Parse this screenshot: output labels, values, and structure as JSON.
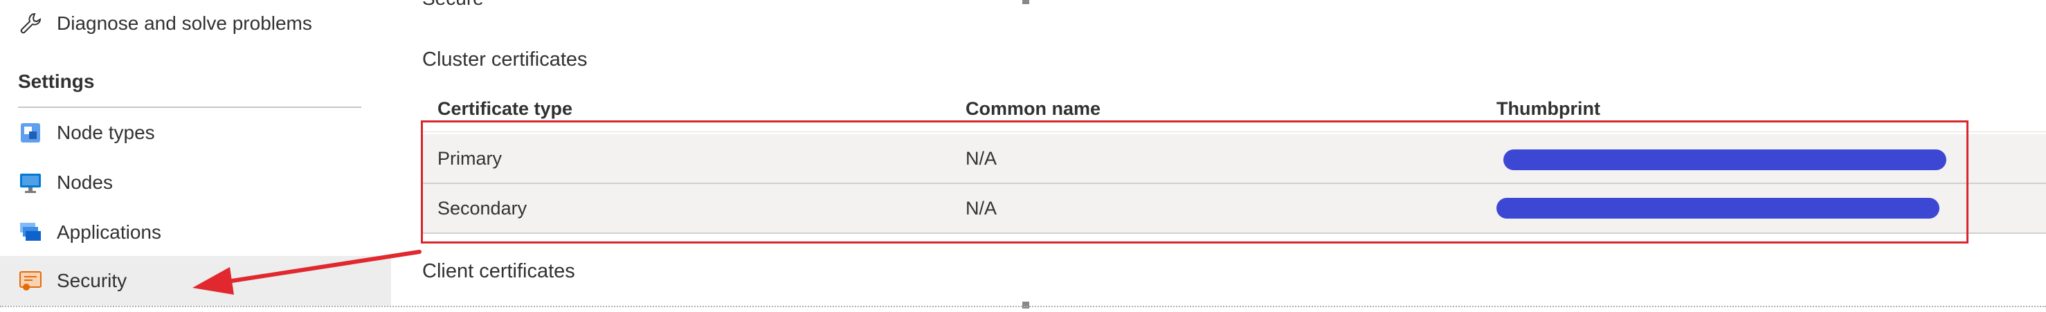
{
  "sidebar": {
    "diagnose_label": "Diagnose and solve problems",
    "settings_heading": "Settings",
    "items": [
      {
        "label": "Node types",
        "icon": "node-types-icon"
      },
      {
        "label": "Nodes",
        "icon": "nodes-icon"
      },
      {
        "label": "Applications",
        "icon": "applications-icon"
      },
      {
        "label": "Security",
        "icon": "security-icon",
        "selected": true
      }
    ]
  },
  "main": {
    "secure_label": "Secure",
    "cluster_certificates_heading": "Cluster certificates",
    "client_certificates_heading": "Client certificates",
    "table": {
      "columns": [
        "Certificate type",
        "Common name",
        "Thumbprint"
      ],
      "rows": [
        {
          "type": "Primary",
          "common_name": "N/A",
          "thumbprint": "redacted"
        },
        {
          "type": "Secondary",
          "common_name": "N/A",
          "thumbprint": "redacted"
        }
      ]
    }
  },
  "annotations": {
    "highlight_color": "#d9262c",
    "arrow_color": "#e0282e",
    "redaction_color": "#3c48d4"
  }
}
